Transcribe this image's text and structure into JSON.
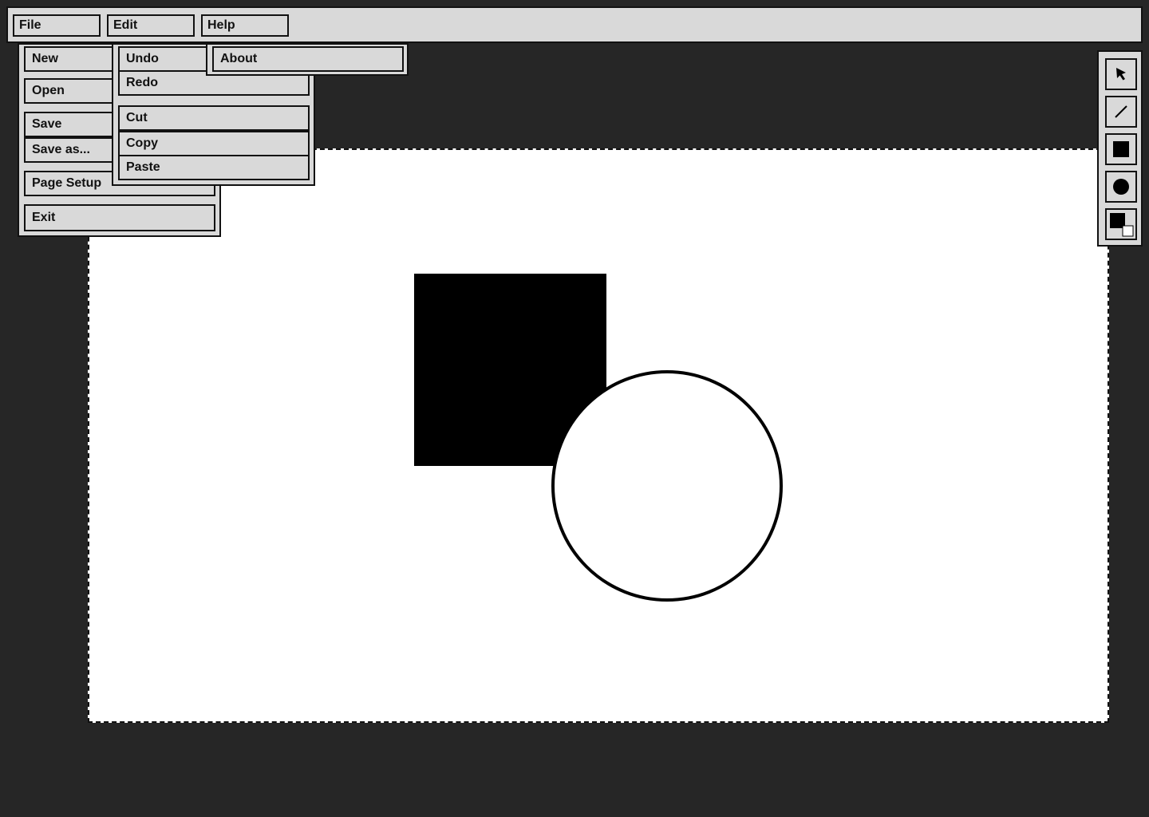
{
  "menubar": {
    "file_label": "File",
    "edit_label": "Edit",
    "help_label": "Help"
  },
  "file_menu": {
    "items": [
      "New",
      "Open",
      "Save",
      "Save as...",
      "Page Setup",
      "Exit"
    ]
  },
  "edit_menu": {
    "items": [
      "Undo",
      "Redo",
      "Cut",
      "Copy",
      "Paste"
    ]
  },
  "help_menu": {
    "items": [
      "About"
    ]
  },
  "toolbar": {
    "tools": [
      "select-arrow-icon",
      "line-tool-icon",
      "rectangle-tool-icon",
      "ellipse-tool-icon",
      "color-swatch-icon"
    ]
  },
  "colors": {
    "background": "#262626",
    "panel": "#d9d9d9",
    "ink": "#111111",
    "canvas": "#ffffff"
  }
}
